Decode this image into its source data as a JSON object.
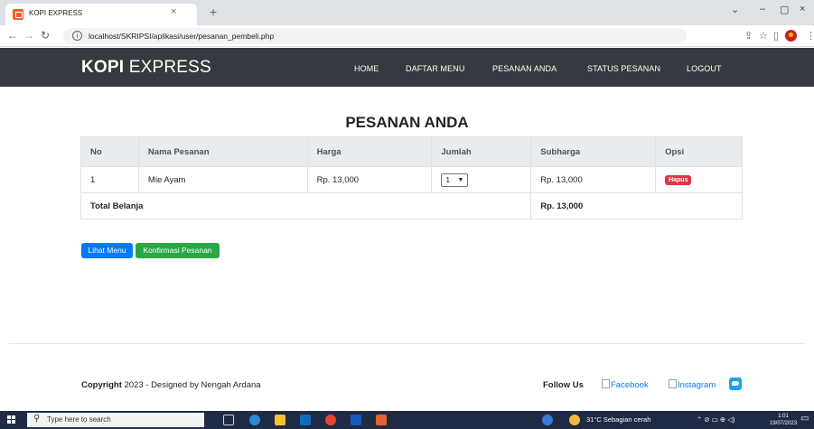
{
  "browser": {
    "tab_title": "KOPI EXPRESS",
    "url": "localhost/SKRIPSI/aplikasi/user/pesanan_pembeli.php",
    "tab_close_icon": "×",
    "new_tab_icon": "+",
    "controls": {
      "minimize": "–",
      "maximize": "▢",
      "close": "×"
    }
  },
  "site": {
    "brand_bold": "KOPI",
    "brand_rest": " EXPRESS",
    "nav": [
      {
        "label": "HOME"
      },
      {
        "label": "DAFTAR MENU"
      },
      {
        "label": "PESANAN ANDA"
      },
      {
        "label": "STATUS PESANAN"
      },
      {
        "label": "LOGOUT"
      }
    ]
  },
  "main": {
    "title": "PESANAN ANDA",
    "columns": [
      "No",
      "Nama Pesanan",
      "Harga",
      "Jumlah",
      "Subharga",
      "Opsi"
    ],
    "rows": [
      {
        "no": "1",
        "nama": "Mie Ayam",
        "harga": "Rp. 13,000",
        "jumlah": "1",
        "subharga": "Rp. 13,000",
        "opsi": "Hapus"
      }
    ],
    "total_label": "Total Belanja",
    "total_value": "Rp. 13,000",
    "btn_lihat": "Lihat Menu",
    "btn_konfirmasi": "Konfirmasi Pesanan"
  },
  "footer": {
    "copyright_bold": "Copyright",
    "copyright_rest": " 2023 - Designed by Nengah Ardana",
    "follow_us": "Follow Us",
    "facebook_alt": "Facebook",
    "instagram_alt": "Instagram"
  },
  "taskbar": {
    "search_placeholder": "Type here to search",
    "weather": "31°C  Sebagian cerah",
    "time": "1:01",
    "date": "19/07/2023"
  },
  "icons": {
    "back": "back-arrow-icon",
    "forward": "forward-arrow-icon",
    "reload": "reload-icon",
    "info": "info-icon",
    "share": "share-icon",
    "star": "bookmark-star-icon",
    "sidepanel": "side-panel-icon",
    "menu": "kebab-menu-icon",
    "twitter": "twitter-icon"
  },
  "colors": {
    "navbar": "#343a40",
    "primary": "#007bff",
    "success": "#28a745",
    "danger": "#dc3545"
  }
}
